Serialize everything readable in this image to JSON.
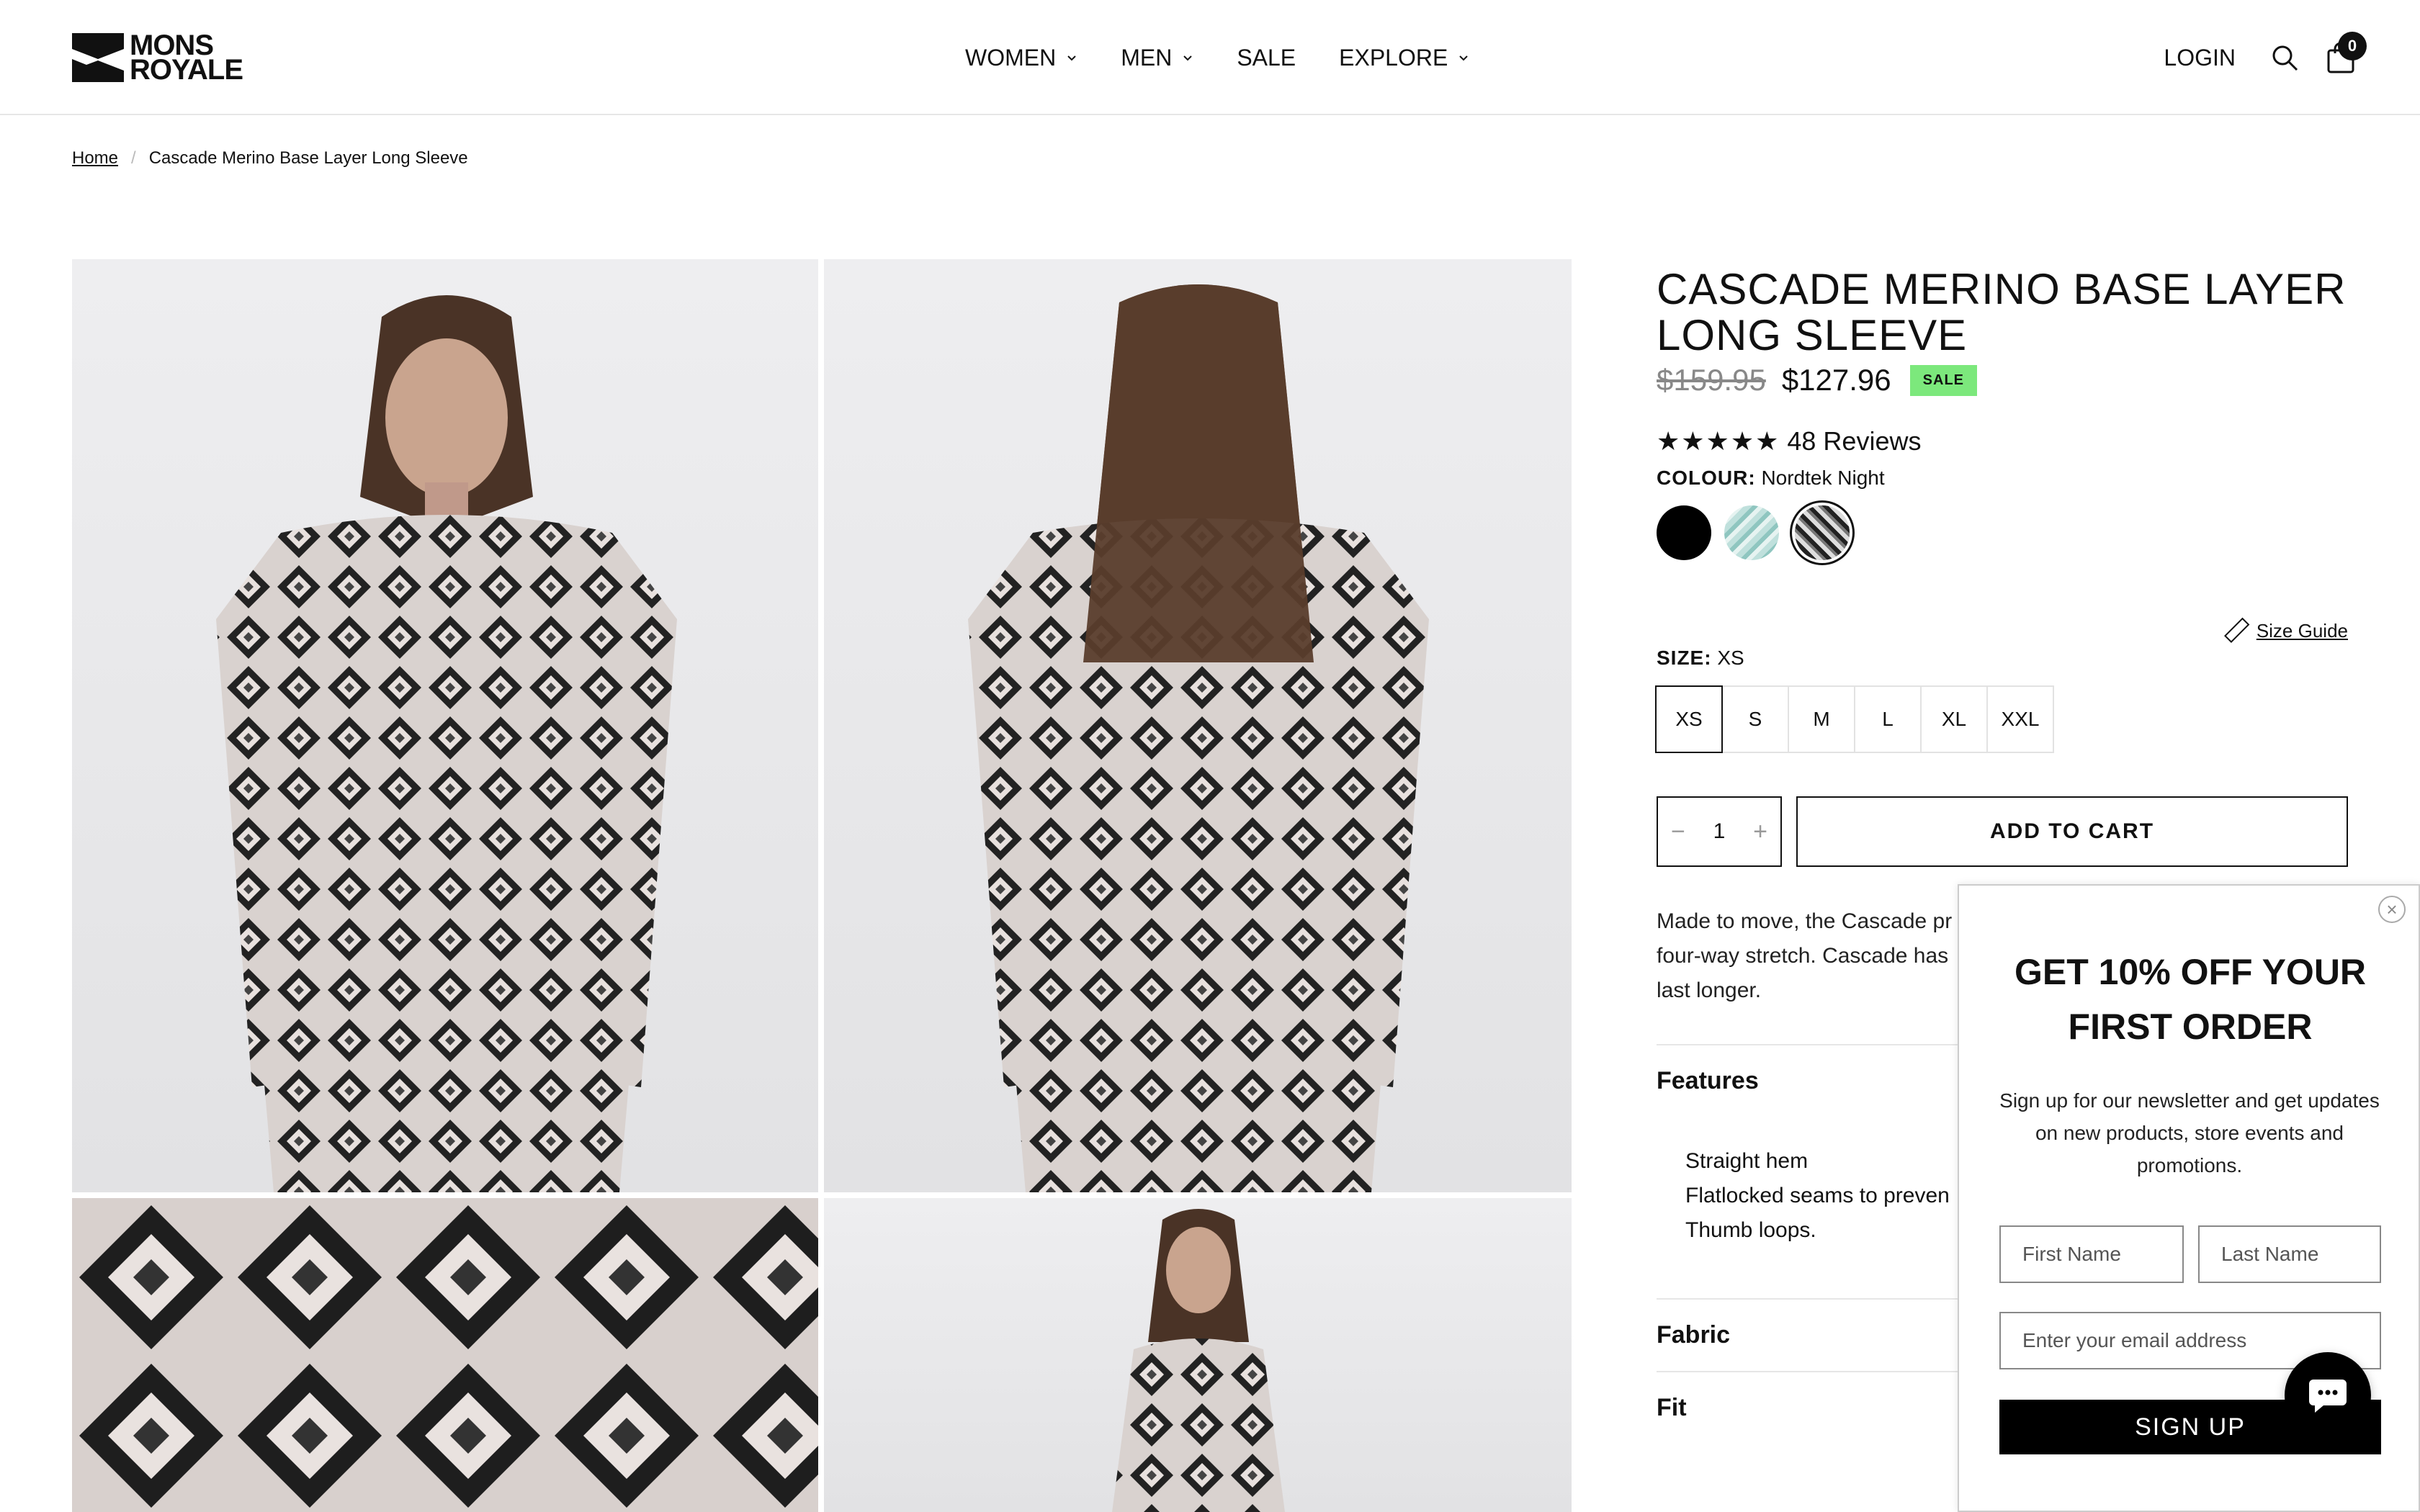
{
  "brand": {
    "logo_line1": "MONS",
    "logo_line2": "ROYALE"
  },
  "nav": {
    "items": [
      {
        "label": "WOMEN",
        "has_dropdown": true
      },
      {
        "label": "MEN",
        "has_dropdown": true
      },
      {
        "label": "SALE",
        "has_dropdown": false
      },
      {
        "label": "EXPLORE",
        "has_dropdown": true
      }
    ],
    "login": "LOGIN",
    "cart_count": "0"
  },
  "breadcrumb": {
    "home": "Home",
    "current": "Cascade Merino Base Layer Long Sleeve"
  },
  "product": {
    "title": "CASCADE MERINO BASE LAYER LONG SLEEVE",
    "old_price": "$159.95",
    "price": "$127.96",
    "badge": "SALE",
    "rating": 5,
    "reviews": "48 Reviews",
    "colour_label": "COLOUR:",
    "colour_value": "Nordtek Night",
    "colours": [
      "black",
      "mint-wave",
      "nordtek-night"
    ],
    "selected_colour": "nordtek-night",
    "size_guide": "Size Guide",
    "size_label": "SIZE:",
    "size_value": "XS",
    "sizes": [
      "XS",
      "S",
      "M",
      "L",
      "XL",
      "XXL"
    ],
    "quantity": "1",
    "add_to_cart": "ADD TO CART",
    "description_lines": [
      "Made to move, the Cascade pr",
      "four-way stretch. Cascade has",
      "last longer."
    ],
    "features_heading": "Features",
    "features": [
      "Straight hem",
      "Flatlocked seams to preven",
      "Thumb loops."
    ],
    "fabric_heading": "Fabric",
    "fit_heading": "Fit"
  },
  "popup": {
    "title_line1": "GET 10% OFF YOUR",
    "title_line2": "FIRST ORDER",
    "text": "Sign up for our newsletter and get updates on new products, store events and promotions.",
    "first_name_placeholder": "First Name",
    "last_name_placeholder": "Last Name",
    "email_placeholder": "Enter your email address",
    "button": "SIGN UP",
    "close": "×"
  },
  "colors": {
    "sale_badge": "#7ce87c",
    "text": "#111111",
    "border": "#e2e2e2"
  }
}
